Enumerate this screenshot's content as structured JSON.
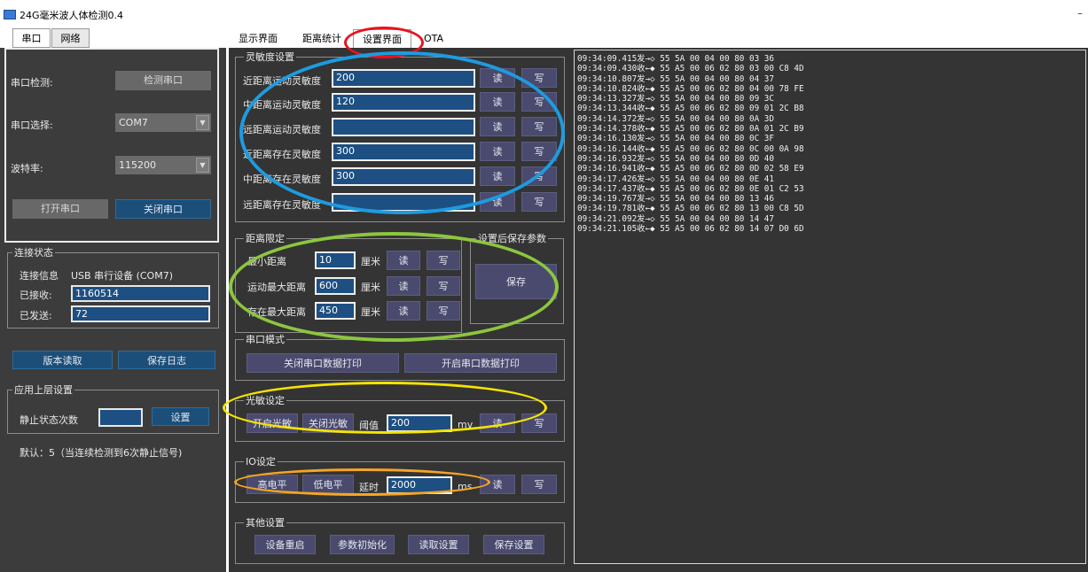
{
  "window": {
    "title": "24G毫米波人体检测0.4",
    "minimize_glyph": "–"
  },
  "left_tabs": [
    {
      "label": "串口",
      "active": true
    },
    {
      "label": "网络",
      "active": false
    }
  ],
  "serial": {
    "detect_label": "串口检测:",
    "detect_button": "检测串口",
    "select_label": "串口选择:",
    "port_value": "COM7",
    "baud_label": "波特率:",
    "baud_value": "115200",
    "open_button": "打开串口",
    "close_button": "关闭串口"
  },
  "conn_status": {
    "title": "连接状态",
    "info_label": "连接信息",
    "info_value": "USB 串行设备 (COM7)",
    "received_label": "已接收:",
    "received_value": "1160514",
    "sent_label": "已发送:",
    "sent_value": "72"
  },
  "left_actions": {
    "version_button": "版本读取",
    "save_log_button": "保存日志"
  },
  "app_settings": {
    "title": "应用上层设置",
    "static_count_label": "静止状态次数",
    "static_count_value": "",
    "set_button": "设置",
    "default_note": "默认：5（当连续检测到6次静止信号)"
  },
  "right_tabs": [
    {
      "label": "显示界面",
      "active": false
    },
    {
      "label": "距离统计",
      "active": false
    },
    {
      "label": "设置界面",
      "active": true
    },
    {
      "label": "OTA",
      "active": false
    }
  ],
  "sensitivity": {
    "title": "灵敏度设置",
    "read_label": "读",
    "write_label": "写",
    "rows": [
      {
        "label": "近距离运动灵敏度",
        "value": "200"
      },
      {
        "label": "中距离运动灵敏度",
        "value": "120"
      },
      {
        "label": "远距离运动灵敏度",
        "value": ""
      },
      {
        "label": "近距离存在灵敏度",
        "value": "300"
      },
      {
        "label": "中距离存在灵敏度",
        "value": "300"
      },
      {
        "label": "远距离存在灵敏度",
        "value": ""
      }
    ]
  },
  "distance": {
    "title": "距离限定",
    "unit": "厘米",
    "read_label": "读",
    "write_label": "写",
    "rows": [
      {
        "label": "最小距离",
        "value": "10"
      },
      {
        "label": "运动最大距离",
        "value": "600"
      },
      {
        "label": "存在最大距离",
        "value": "450"
      }
    ]
  },
  "save_params": {
    "title": "设置后保存参数",
    "button": "保存"
  },
  "serial_mode": {
    "title": "串口模式",
    "off_button": "关闭串口数据打印",
    "on_button": "开启串口数据打印"
  },
  "light": {
    "title": "光敏设定",
    "on_button": "开启光敏",
    "off_button": "关闭光敏",
    "threshold_label": "阈值",
    "threshold_value": "200",
    "unit": "mv",
    "read_label": "读",
    "write_label": "写"
  },
  "io": {
    "title": "IO设定",
    "high_button": "高电平",
    "low_button": "低电平",
    "delay_label": "延时",
    "delay_value": "2000",
    "unit": "ms",
    "read_label": "读",
    "write_label": "写"
  },
  "other": {
    "title": "其他设置",
    "restart_button": "设备重启",
    "init_button": "参数初始化",
    "read_button": "读取设置",
    "save_button": "保存设置"
  },
  "log_lines": [
    "09:34:09.415发→◇ 55 5A 00 04 00 80 03 36",
    "09:34:09.430收←◆ 55 A5 00 06 02 80 03 00 C8 4D",
    "09:34:10.807发→◇ 55 5A 00 04 00 80 04 37",
    "09:34:10.824收←◆ 55 A5 00 06 02 80 04 00 78 FE",
    "09:34:13.327发→◇ 55 5A 00 04 00 80 09 3C",
    "09:34:13.344收←◆ 55 A5 00 06 02 80 09 01 2C B8",
    "09:34:14.372发→◇ 55 5A 00 04 00 80 0A 3D",
    "09:34:14.378收←◆ 55 A5 00 06 02 80 0A 01 2C B9",
    "09:34:16.130发→◇ 55 5A 00 04 00 80 0C 3F",
    "09:34:16.144收←◆ 55 A5 00 06 02 80 0C 00 0A 98",
    "09:34:16.932发→◇ 55 5A 00 04 00 80 0D 40",
    "09:34:16.941收←◆ 55 A5 00 06 02 80 0D 02 58 E9",
    "09:34:17.426发→◇ 55 5A 00 04 00 80 0E 41",
    "09:34:17.437收←◆ 55 A5 00 06 02 80 0E 01 C2 53",
    "09:34:19.767发→◇ 55 5A 00 04 00 80 13 46",
    "09:34:19.781收←◆ 55 A5 00 06 02 80 13 00 C8 5D",
    "09:34:21.092发→◇ 55 5A 00 04 00 80 14 47",
    "09:34:21.105收←◆ 55 A5 00 06 02 80 14 07 D0 6D"
  ],
  "annotation_colors": {
    "red": "#e8121e",
    "blue": "#1e9be0",
    "green": "#8cc63f",
    "yellow": "#f7e400",
    "orange": "#f5a623"
  }
}
